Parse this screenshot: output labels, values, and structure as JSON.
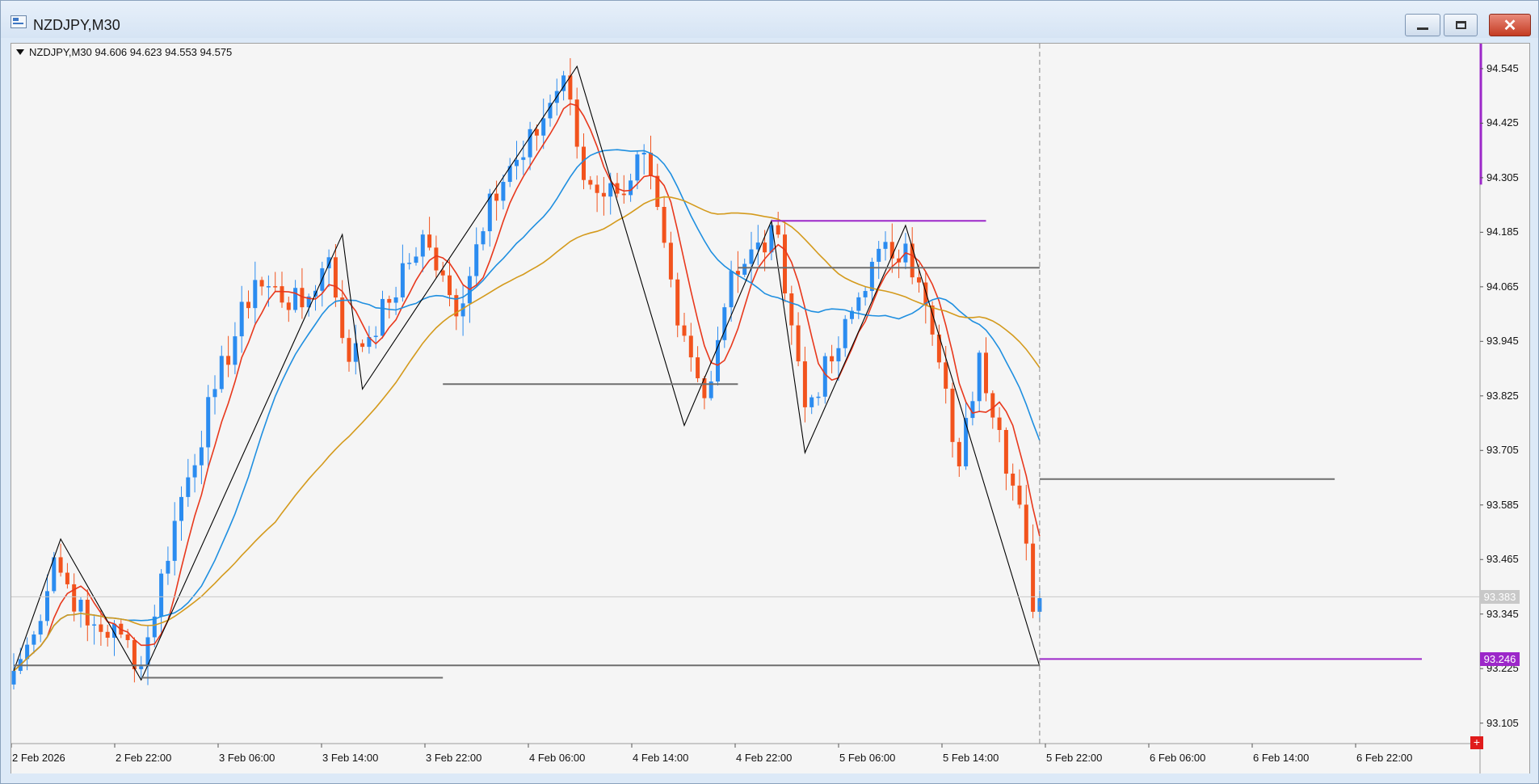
{
  "window": {
    "title": "NZDJPY,M30",
    "min_label": "",
    "max_label": "",
    "close_label": "✕"
  },
  "chart": {
    "symbol_line": "NZDJPY,M30  94.606 94.623 94.553 94.575",
    "current_price": "93.383",
    "purple_level_price": "93.246",
    "plus_label": "+",
    "colors": {
      "background": "#f5f5f5",
      "bull": "#2b8cf0",
      "bear": "#f2531d",
      "ma_fast": "#e8381c",
      "ma_mid": "#1f8fe0",
      "ma_slow": "#d49a1c",
      "zigzag": "#000000",
      "level_gray": "#6e6e6e",
      "level_purple": "#9c27c9"
    }
  },
  "chart_data": {
    "type": "candlestick",
    "symbol": "NZDJPY",
    "timeframe": "M30",
    "ohlc_header": {
      "open": 94.606,
      "high": 94.623,
      "low": 94.553,
      "close": 94.575
    },
    "ylim": [
      93.06,
      94.6
    ],
    "price_ticks": [
      "94.545",
      "94.425",
      "94.305",
      "94.185",
      "94.065",
      "93.945",
      "93.825",
      "93.705",
      "93.585",
      "93.465",
      "93.345",
      "93.225",
      "93.105"
    ],
    "time_ticks": [
      "2 Feb 2026",
      "2 Feb 22:00",
      "3 Feb 06:00",
      "3 Feb 14:00",
      "3 Feb 22:00",
      "4 Feb 06:00",
      "4 Feb 14:00",
      "4 Feb 22:00",
      "5 Feb 06:00",
      "5 Feb 14:00",
      "5 Feb 22:00",
      "6 Feb 06:00",
      "6 Feb 14:00",
      "6 Feb 22:00"
    ],
    "anchors": [
      {
        "bar": 0,
        "price": 93.22
      },
      {
        "bar": 3,
        "price": 93.3
      },
      {
        "bar": 6,
        "price": 93.47
      },
      {
        "bar": 11,
        "price": 93.32
      },
      {
        "bar": 16,
        "price": 93.3
      },
      {
        "bar": 19,
        "price": 93.23
      },
      {
        "bar": 24,
        "price": 93.55
      },
      {
        "bar": 30,
        "price": 93.84
      },
      {
        "bar": 36,
        "price": 94.08
      },
      {
        "bar": 43,
        "price": 94.02
      },
      {
        "bar": 47,
        "price": 94.13
      },
      {
        "bar": 50,
        "price": 93.9
      },
      {
        "bar": 56,
        "price": 94.03
      },
      {
        "bar": 61,
        "price": 94.18
      },
      {
        "bar": 66,
        "price": 94.0
      },
      {
        "bar": 71,
        "price": 94.27
      },
      {
        "bar": 76,
        "price": 94.35
      },
      {
        "bar": 82,
        "price": 94.53
      },
      {
        "bar": 85,
        "price": 94.3
      },
      {
        "bar": 90,
        "price": 94.27
      },
      {
        "bar": 94,
        "price": 94.36
      },
      {
        "bar": 99,
        "price": 93.98
      },
      {
        "bar": 103,
        "price": 93.82
      },
      {
        "bar": 107,
        "price": 94.1
      },
      {
        "bar": 114,
        "price": 94.18
      },
      {
        "bar": 118,
        "price": 93.8
      },
      {
        "bar": 123,
        "price": 93.93
      },
      {
        "bar": 128,
        "price": 94.12
      },
      {
        "bar": 133,
        "price": 94.16
      },
      {
        "bar": 137,
        "price": 93.96
      },
      {
        "bar": 141,
        "price": 93.67
      },
      {
        "bar": 144,
        "price": 93.92
      },
      {
        "bar": 147,
        "price": 93.75
      },
      {
        "bar": 151,
        "price": 93.5
      },
      {
        "bar": 152,
        "price": 93.35
      },
      {
        "bar": 153,
        "price": 93.38
      }
    ],
    "zigzag": [
      {
        "bar": 0,
        "price": 93.22
      },
      {
        "bar": 7,
        "price": 93.51
      },
      {
        "bar": 19,
        "price": 93.2
      },
      {
        "bar": 49,
        "price": 94.18
      },
      {
        "bar": 52,
        "price": 93.84
      },
      {
        "bar": 84,
        "price": 94.55
      },
      {
        "bar": 100,
        "price": 93.76
      },
      {
        "bar": 113,
        "price": 94.21
      },
      {
        "bar": 118,
        "price": 93.7
      },
      {
        "bar": 133,
        "price": 94.2
      },
      {
        "bar": 153,
        "price": 93.23
      }
    ],
    "levels": [
      {
        "price": 93.232,
        "from_bar": 0,
        "to_bar": 153,
        "color": "gray"
      },
      {
        "price": 93.205,
        "from_bar": 19,
        "to_bar": 64,
        "color": "gray"
      },
      {
        "price": 93.851,
        "from_bar": 64,
        "to_bar": 108,
        "color": "gray"
      },
      {
        "price": 94.107,
        "from_bar": 108,
        "to_bar": 153,
        "color": "gray"
      },
      {
        "price": 94.21,
        "from_bar": 113,
        "to_bar": 145,
        "color": "purple"
      },
      {
        "price": 93.642,
        "from_bar": 153,
        "to_bar": 197,
        "color": "gray"
      },
      {
        "price": 93.246,
        "from_bar": 153,
        "to_bar": 210,
        "color": "purple"
      }
    ],
    "moving_averages": [
      {
        "name": "fast",
        "period": 6,
        "color": "#e8381c"
      },
      {
        "name": "mid",
        "period": 18,
        "color": "#1f8fe0"
      },
      {
        "name": "slow",
        "period": 40,
        "color": "#d49a1c"
      }
    ]
  }
}
